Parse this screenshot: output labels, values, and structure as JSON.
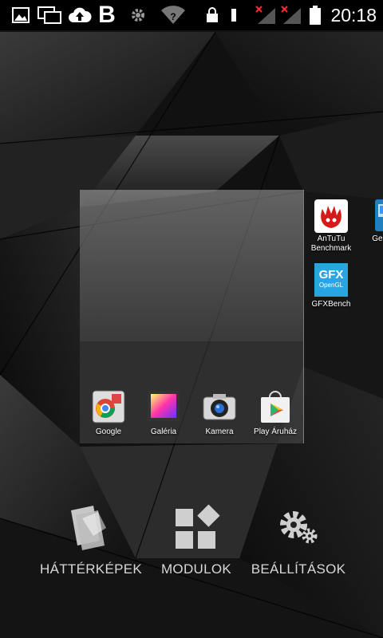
{
  "status_bar": {
    "time": "20:18",
    "icons": [
      "image-icon",
      "screen-mirror-icon",
      "cloud-upload-icon",
      "b-icon",
      "gear-icon",
      "wifi-icon",
      "lock-icon",
      "vibrate-icon",
      "signal-no-service-icon",
      "signal-no-service-icon",
      "battery-icon"
    ]
  },
  "preview_dock": [
    {
      "label": "Google",
      "icon": "google-folder-icon"
    },
    {
      "label": "Galéria",
      "icon": "gallery-icon"
    },
    {
      "label": "Kamera",
      "icon": "camera-icon"
    },
    {
      "label": "Play Áruház",
      "icon": "play-store-icon"
    }
  ],
  "next_page_apps": [
    {
      "label": "AnTuTu Benchmark",
      "icon": "antutu-icon"
    },
    {
      "label": "Geekb",
      "icon": "geekbench-icon"
    },
    {
      "label": "GFXBench",
      "icon": "gfxbench-icon",
      "icon_text_1": "GFX",
      "icon_text_2": "OpenGL"
    }
  ],
  "options": [
    {
      "label": "HÁTTÉRKÉPEK",
      "icon": "wallpapers-icon"
    },
    {
      "label": "MODULOK",
      "icon": "widgets-icon"
    },
    {
      "label": "BEÁLLÍTÁSOK",
      "icon": "settings-icon"
    }
  ]
}
